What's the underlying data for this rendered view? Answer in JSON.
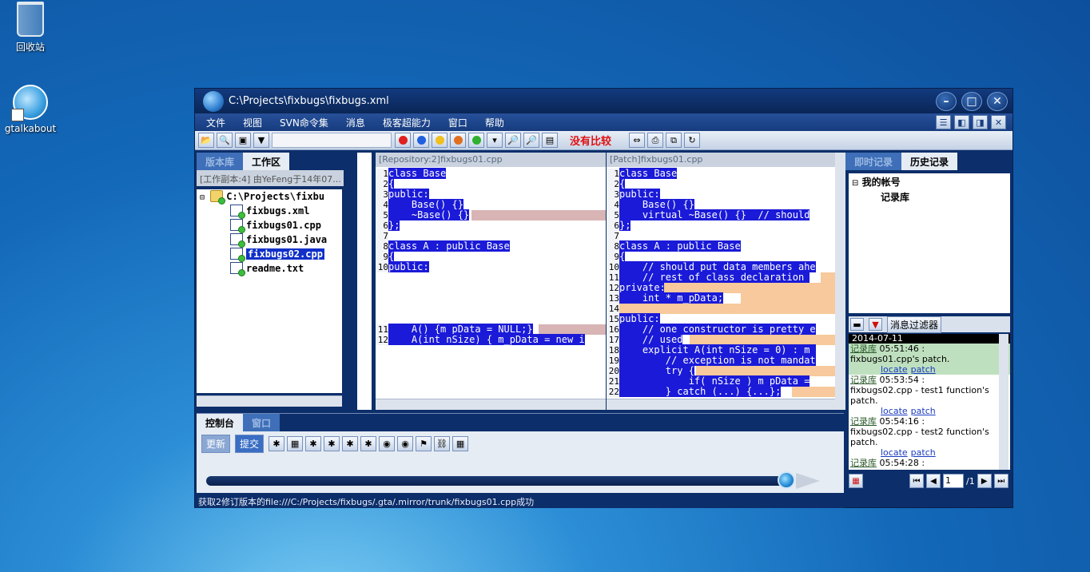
{
  "desktop": {
    "icons": [
      {
        "label": "回收站"
      },
      {
        "label": "gtalkabout"
      }
    ]
  },
  "window": {
    "title": "C:\\Projects\\fixbugs\\fixbugs.xml",
    "menu": [
      "文件",
      "视图",
      "SVN命令集",
      "消息",
      "极客超能力",
      "窗口",
      "帮助"
    ],
    "toolbar_status": "没有比较"
  },
  "left_panel": {
    "tabs": [
      "版本库",
      "工作区"
    ],
    "active_tab": "工作区",
    "wc_header": "[工作副本:4] 由YeFeng于14年07...",
    "tree": {
      "root": "C:\\Projects\\fixbu",
      "files": [
        "fixbugs.xml",
        "fixbugs01.cpp",
        "fixbugs01.java",
        "fixbugs02.cpp",
        "readme.txt"
      ],
      "selected": "fixbugs02.cpp"
    }
  },
  "diff": {
    "left": {
      "title": "[Repository:2]fixbugs01.cpp",
      "lines": [
        {
          "n": "1",
          "t": "class Base"
        },
        {
          "n": "2",
          "t": "{"
        },
        {
          "n": "3",
          "t": "public:"
        },
        {
          "n": "4",
          "t": "    Base() {}"
        },
        {
          "n": "5",
          "t": "    ~Base() {}"
        },
        {
          "n": "6",
          "t": "};"
        },
        {
          "n": "7",
          "t": ""
        },
        {
          "n": "8",
          "t": "class A : public Base"
        },
        {
          "n": "9",
          "t": "{"
        },
        {
          "n": "10",
          "t": "public:"
        },
        {
          "n": "11",
          "t": "    A() {m_pData = NULL;}"
        },
        {
          "n": "12",
          "t": "    A(int nSize) { m_pData = new i"
        }
      ]
    },
    "right": {
      "title": "[Patch]fixbugs01.cpp",
      "lines": [
        {
          "n": "1",
          "t": "class Base"
        },
        {
          "n": "2",
          "t": "{"
        },
        {
          "n": "3",
          "t": "public:"
        },
        {
          "n": "4",
          "t": "    Base() {}"
        },
        {
          "n": "5",
          "t": "    virtual ~Base() {}  // should"
        },
        {
          "n": "6",
          "t": "};"
        },
        {
          "n": "7",
          "t": ""
        },
        {
          "n": "8",
          "t": "class A : public Base"
        },
        {
          "n": "9",
          "t": "{"
        },
        {
          "n": "10",
          "t": "    // should put data members ahe"
        },
        {
          "n": "11",
          "t": "    // rest of class declaration "
        },
        {
          "n": "12",
          "t": "private:"
        },
        {
          "n": "13",
          "t": "    int * m_pData;"
        },
        {
          "n": "14",
          "t": ""
        },
        {
          "n": "15",
          "t": "public:"
        },
        {
          "n": "16",
          "t": "    // one constructor is pretty e"
        },
        {
          "n": "17",
          "t": "    // used"
        },
        {
          "n": "18",
          "t": "    explicit A(int nSize = 0) : m_"
        },
        {
          "n": "19",
          "t": "        // exception is not mandat"
        },
        {
          "n": "20",
          "t": "        try {"
        },
        {
          "n": "21",
          "t": "            if( nSize ) m_pData ="
        },
        {
          "n": "22",
          "t": "        } catch (...) {...};"
        }
      ]
    }
  },
  "console": {
    "tabs": [
      "控制台",
      "窗口"
    ],
    "active_tab": "控制台",
    "update_label": "更新",
    "submit_label": "提交"
  },
  "status_bar": "获取2修订版本的file:///C:/Projects/fixbugs/.gta/.mirror/trunk/fixbugs01.cpp成功",
  "right_panel": {
    "tabs": [
      "即时记录",
      "历史记录"
    ],
    "active_tab": "历史记录",
    "tree": {
      "root": "我的帐号",
      "child": "记录库"
    },
    "filter_label": "消息过滤器",
    "date": "2014-07-11",
    "messages": [
      {
        "who": "记录库",
        "time": "05:51:46 :",
        "text": "fixbugs01.cpp's patch."
      },
      {
        "who": "记录库",
        "time": "05:53:54 :",
        "text": "fixbugs02.cpp - test1 function's patch."
      },
      {
        "who": "记录库",
        "time": "05:54:16 :",
        "text": "fixbugs02.cpp - test2 function's patch."
      },
      {
        "who": "记录库",
        "time": "05:54:28 :",
        "text": ""
      }
    ],
    "link_locate": "locate",
    "link_patch": "patch",
    "page_input": "1",
    "page_total": "/1"
  }
}
